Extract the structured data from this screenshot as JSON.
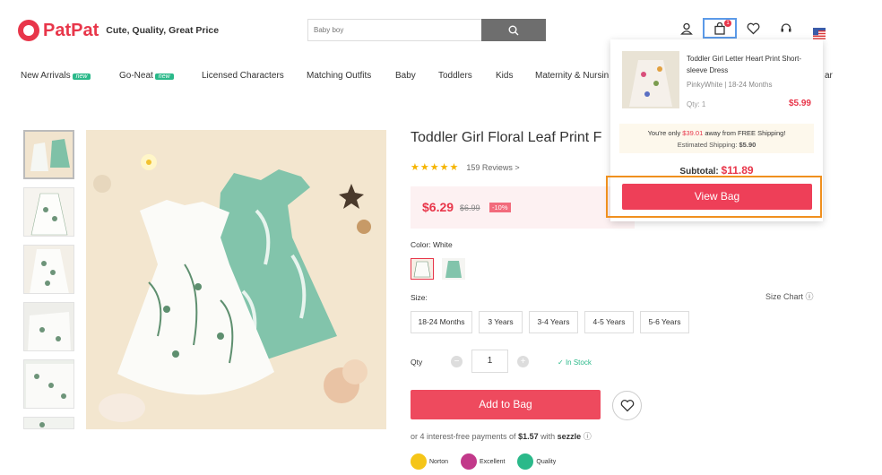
{
  "header": {
    "logo_text": "PatPat",
    "tagline": "Cute, Quality, Great Price",
    "search_placeholder": "Baby boy",
    "cart_count": "1"
  },
  "nav": {
    "items": [
      {
        "label": "New Arrivals",
        "tag": "new"
      },
      {
        "label": "Go-Neat",
        "tag": "new"
      },
      {
        "label": "Licensed Characters"
      },
      {
        "label": "Matching Outfits"
      },
      {
        "label": "Baby"
      },
      {
        "label": "Toddlers"
      },
      {
        "label": "Kids"
      },
      {
        "label": "Maternity & Nursin"
      },
      {
        "label": "ar"
      }
    ]
  },
  "product": {
    "title": "Toddler Girl Floral Leaf Print F",
    "reviews": "159 Reviews",
    "review_chevron": ">",
    "rating_stars": 5,
    "price": "$6.29",
    "price_old": "$6.99",
    "discount": "-10%",
    "color_label": "Color: White",
    "size_label": "Size:",
    "size_chart": "Size Chart",
    "sizes": [
      "18-24 Months",
      "3 Years",
      "3-4 Years",
      "4-5 Years",
      "5-6 Years"
    ],
    "qty_label": "Qty",
    "qty_value": "1",
    "qty_minus": "−",
    "qty_plus": "+",
    "stock": "In Stock",
    "add_to_bag": "Add to Bag",
    "installments_prefix": "or 4 interest-free payments of",
    "installments_amount": "$1.57",
    "installments_with": "with",
    "installments_provider": "sezzle",
    "trust_badges": [
      "Norton",
      "Excellent",
      "Quality"
    ]
  },
  "cart_popup": {
    "item_name": "Toddler Girl Letter Heart Print Short-sleeve Dress",
    "item_variant": "PinkyWhite | 18-24 Months",
    "item_qty": "Qty: 1",
    "item_price": "$5.99",
    "shipping_pre": "You're only",
    "shipping_amount": "$39.01",
    "shipping_post": "away from FREE Shipping!",
    "estimated_label": "Estimated Shipping:",
    "estimated_value": "$5.90",
    "subtotal_label": "Subtotal:",
    "subtotal_value": "$11.89",
    "view_bag": "View Bag"
  },
  "colors": {
    "brand": "#e8364a",
    "accent_green": "#2bb98a",
    "highlight_blue": "#5b9ae8",
    "highlight_orange": "#f0901e"
  }
}
